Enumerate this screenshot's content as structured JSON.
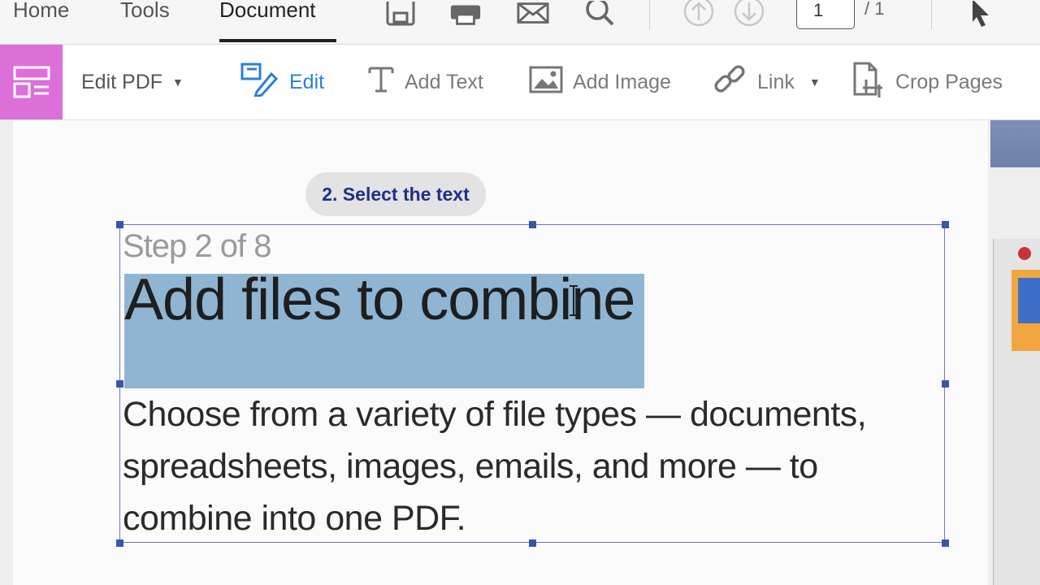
{
  "nav": {
    "tabs": [
      {
        "label": "Home"
      },
      {
        "label": "Tools"
      },
      {
        "label": "Document"
      }
    ],
    "page_current": "1",
    "page_total": "/ 1",
    "icons": [
      "save-icon",
      "print-icon",
      "mail-icon",
      "search-icon",
      "page-up-icon",
      "page-down-icon",
      "pointer-icon"
    ]
  },
  "toolbar": {
    "mode_label": "Edit PDF",
    "edit_label": "Edit",
    "add_text_label": "Add Text",
    "add_image_label": "Add Image",
    "link_label": "Link",
    "crop_label": "Crop Pages"
  },
  "document": {
    "callout": "2. Select the text",
    "step": "Step 2 of 8",
    "headline": "Add files to combine",
    "body": "Choose from a variety of file types — documents, spreadsheets, images, emails, and more — to combine into one PDF."
  },
  "colors": {
    "accent_mode": "#dd6fd8",
    "edit_blue": "#2d7fd3",
    "selection_highlight": "#8fb5d3",
    "callout_text": "#1f2f8a"
  }
}
